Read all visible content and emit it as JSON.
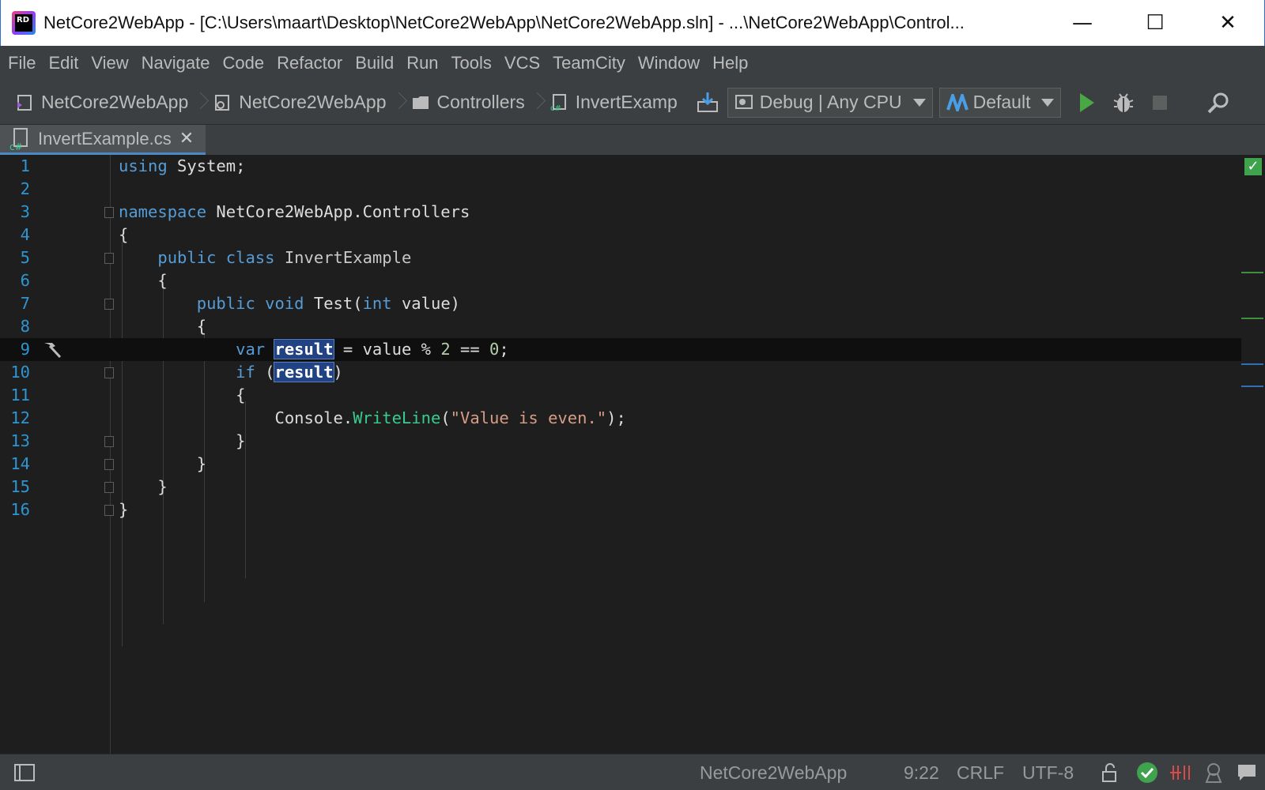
{
  "window": {
    "title": "NetCore2WebApp - [C:\\Users\\maart\\Desktop\\NetCore2WebApp\\NetCore2WebApp.sln] - ...\\NetCore2WebApp\\Control...",
    "logo_text": "RD",
    "minimize": "—",
    "maximize": "☐",
    "close": "✕"
  },
  "menu": [
    "File",
    "Edit",
    "View",
    "Navigate",
    "Code",
    "Refactor",
    "Build",
    "Run",
    "Tools",
    "VCS",
    "TeamCity",
    "Window",
    "Help"
  ],
  "breadcrumb": [
    {
      "label": "NetCore2WebApp",
      "icon": "solution-icon"
    },
    {
      "label": "NetCore2WebApp",
      "icon": "project-icon"
    },
    {
      "label": "Controllers",
      "icon": "folder-icon"
    },
    {
      "label": "InvertExamp",
      "icon": "csharp-file-icon"
    }
  ],
  "toolbar": {
    "config": "Debug | Any CPU",
    "runtime": "Default"
  },
  "tab": {
    "label": "InvertExample.cs",
    "close": "✕"
  },
  "editor": {
    "line_numbers": [
      "1",
      "2",
      "3",
      "4",
      "5",
      "6",
      "7",
      "8",
      "9",
      "10",
      "11",
      "12",
      "13",
      "14",
      "15",
      "16"
    ],
    "current_line": 9,
    "check": "✓"
  },
  "status": {
    "project": "NetCore2WebApp",
    "position": "9:22",
    "line_ending": "CRLF",
    "encoding": "UTF-8"
  }
}
